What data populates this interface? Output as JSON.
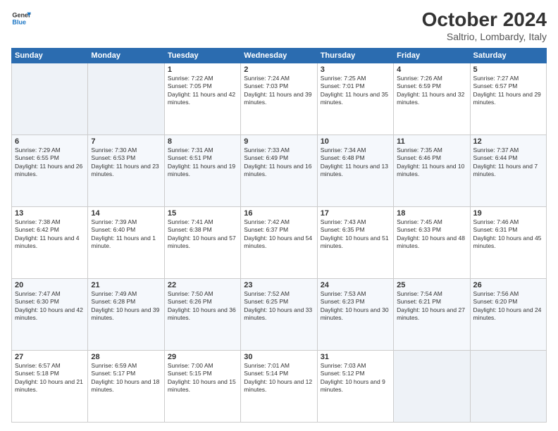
{
  "header": {
    "logo_line1": "General",
    "logo_line2": "Blue",
    "month": "October 2024",
    "location": "Saltrio, Lombardy, Italy"
  },
  "weekdays": [
    "Sunday",
    "Monday",
    "Tuesday",
    "Wednesday",
    "Thursday",
    "Friday",
    "Saturday"
  ],
  "weeks": [
    [
      {
        "day": "",
        "info": ""
      },
      {
        "day": "",
        "info": ""
      },
      {
        "day": "1",
        "info": "Sunrise: 7:22 AM\nSunset: 7:05 PM\nDaylight: 11 hours and 42 minutes."
      },
      {
        "day": "2",
        "info": "Sunrise: 7:24 AM\nSunset: 7:03 PM\nDaylight: 11 hours and 39 minutes."
      },
      {
        "day": "3",
        "info": "Sunrise: 7:25 AM\nSunset: 7:01 PM\nDaylight: 11 hours and 35 minutes."
      },
      {
        "day": "4",
        "info": "Sunrise: 7:26 AM\nSunset: 6:59 PM\nDaylight: 11 hours and 32 minutes."
      },
      {
        "day": "5",
        "info": "Sunrise: 7:27 AM\nSunset: 6:57 PM\nDaylight: 11 hours and 29 minutes."
      }
    ],
    [
      {
        "day": "6",
        "info": "Sunrise: 7:29 AM\nSunset: 6:55 PM\nDaylight: 11 hours and 26 minutes."
      },
      {
        "day": "7",
        "info": "Sunrise: 7:30 AM\nSunset: 6:53 PM\nDaylight: 11 hours and 23 minutes."
      },
      {
        "day": "8",
        "info": "Sunrise: 7:31 AM\nSunset: 6:51 PM\nDaylight: 11 hours and 19 minutes."
      },
      {
        "day": "9",
        "info": "Sunrise: 7:33 AM\nSunset: 6:49 PM\nDaylight: 11 hours and 16 minutes."
      },
      {
        "day": "10",
        "info": "Sunrise: 7:34 AM\nSunset: 6:48 PM\nDaylight: 11 hours and 13 minutes."
      },
      {
        "day": "11",
        "info": "Sunrise: 7:35 AM\nSunset: 6:46 PM\nDaylight: 11 hours and 10 minutes."
      },
      {
        "day": "12",
        "info": "Sunrise: 7:37 AM\nSunset: 6:44 PM\nDaylight: 11 hours and 7 minutes."
      }
    ],
    [
      {
        "day": "13",
        "info": "Sunrise: 7:38 AM\nSunset: 6:42 PM\nDaylight: 11 hours and 4 minutes."
      },
      {
        "day": "14",
        "info": "Sunrise: 7:39 AM\nSunset: 6:40 PM\nDaylight: 11 hours and 1 minute."
      },
      {
        "day": "15",
        "info": "Sunrise: 7:41 AM\nSunset: 6:38 PM\nDaylight: 10 hours and 57 minutes."
      },
      {
        "day": "16",
        "info": "Sunrise: 7:42 AM\nSunset: 6:37 PM\nDaylight: 10 hours and 54 minutes."
      },
      {
        "day": "17",
        "info": "Sunrise: 7:43 AM\nSunset: 6:35 PM\nDaylight: 10 hours and 51 minutes."
      },
      {
        "day": "18",
        "info": "Sunrise: 7:45 AM\nSunset: 6:33 PM\nDaylight: 10 hours and 48 minutes."
      },
      {
        "day": "19",
        "info": "Sunrise: 7:46 AM\nSunset: 6:31 PM\nDaylight: 10 hours and 45 minutes."
      }
    ],
    [
      {
        "day": "20",
        "info": "Sunrise: 7:47 AM\nSunset: 6:30 PM\nDaylight: 10 hours and 42 minutes."
      },
      {
        "day": "21",
        "info": "Sunrise: 7:49 AM\nSunset: 6:28 PM\nDaylight: 10 hours and 39 minutes."
      },
      {
        "day": "22",
        "info": "Sunrise: 7:50 AM\nSunset: 6:26 PM\nDaylight: 10 hours and 36 minutes."
      },
      {
        "day": "23",
        "info": "Sunrise: 7:52 AM\nSunset: 6:25 PM\nDaylight: 10 hours and 33 minutes."
      },
      {
        "day": "24",
        "info": "Sunrise: 7:53 AM\nSunset: 6:23 PM\nDaylight: 10 hours and 30 minutes."
      },
      {
        "day": "25",
        "info": "Sunrise: 7:54 AM\nSunset: 6:21 PM\nDaylight: 10 hours and 27 minutes."
      },
      {
        "day": "26",
        "info": "Sunrise: 7:56 AM\nSunset: 6:20 PM\nDaylight: 10 hours and 24 minutes."
      }
    ],
    [
      {
        "day": "27",
        "info": "Sunrise: 6:57 AM\nSunset: 5:18 PM\nDaylight: 10 hours and 21 minutes."
      },
      {
        "day": "28",
        "info": "Sunrise: 6:59 AM\nSunset: 5:17 PM\nDaylight: 10 hours and 18 minutes."
      },
      {
        "day": "29",
        "info": "Sunrise: 7:00 AM\nSunset: 5:15 PM\nDaylight: 10 hours and 15 minutes."
      },
      {
        "day": "30",
        "info": "Sunrise: 7:01 AM\nSunset: 5:14 PM\nDaylight: 10 hours and 12 minutes."
      },
      {
        "day": "31",
        "info": "Sunrise: 7:03 AM\nSunset: 5:12 PM\nDaylight: 10 hours and 9 minutes."
      },
      {
        "day": "",
        "info": ""
      },
      {
        "day": "",
        "info": ""
      }
    ]
  ]
}
